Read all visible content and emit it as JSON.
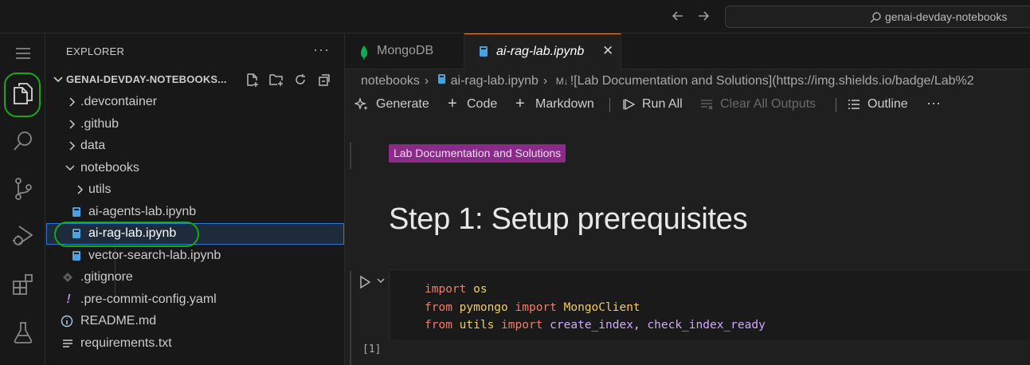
{
  "titlebar": {
    "back_icon": "arrow-left-icon",
    "forward_icon": "arrow-right-icon",
    "search_text": "genai-devday-notebooks"
  },
  "activity_bar": {
    "items": [
      "files-icon",
      "search-icon",
      "source-control-icon",
      "run-debug-icon",
      "extensions-icon",
      "testing-icon"
    ],
    "active": "files-icon"
  },
  "explorer": {
    "title": "EXPLORER",
    "more": "···",
    "workspace": "GENAI-DEVDAY-NOTEBOOKS...",
    "tree": [
      {
        "label": ".devcontainer",
        "type": "folder",
        "expanded": false
      },
      {
        "label": ".github",
        "type": "folder",
        "expanded": false
      },
      {
        "label": "data",
        "type": "folder",
        "expanded": false
      },
      {
        "label": "notebooks",
        "type": "folder",
        "expanded": true
      },
      {
        "label": "utils",
        "type": "folder",
        "expanded": false
      },
      {
        "label": "ai-agents-lab.ipynb",
        "type": "notebook"
      },
      {
        "label": "ai-rag-lab.ipynb",
        "type": "notebook",
        "selected": true
      },
      {
        "label": "vector-search-lab.ipynb",
        "type": "notebook"
      },
      {
        "label": ".gitignore",
        "type": "gitignore"
      },
      {
        "label": ".pre-commit-config.yaml",
        "type": "yaml"
      },
      {
        "label": "README.md",
        "type": "info"
      },
      {
        "label": "requirements.txt",
        "type": "text"
      }
    ]
  },
  "tabs": [
    {
      "label": "MongoDB",
      "icon": "mongodb-leaf-icon",
      "active": false
    },
    {
      "label": "ai-rag-lab.ipynb",
      "icon": "notebook-icon",
      "active": true,
      "close": "✕"
    }
  ],
  "breadcrumbs": {
    "b1": "notebooks",
    "sep": "›",
    "b2": "ai-rag-lab.ipynb",
    "b3_prefix": "M↓",
    "b3": "![Lab Documentation and Solutions](https://img.shields.io/badge/Lab%2"
  },
  "toolbar": {
    "generate": "Generate",
    "code": "Code",
    "markdown": "Markdown",
    "run_all": "Run All",
    "clear_outputs": "Clear All Outputs",
    "outline": "Outline",
    "more": "···"
  },
  "notebook": {
    "badge": "Lab Documentation and Solutions",
    "badge_color": "#8b2a8b",
    "heading": "Step 1: Setup prerequisites",
    "execution_count": "[1]",
    "code": {
      "l1_kw": "import",
      "l1_mod": "os",
      "l2_kw": "from",
      "l2_mod": "pymongo",
      "l2_kw2": "import",
      "l2_cls": "MongoClient",
      "l3_kw": "from",
      "l3_mod": "utils",
      "l3_kw2": "import",
      "l3_fn1": "create_index",
      "l3_comma": ",",
      "l3_fn2": "check_index_ready"
    }
  }
}
